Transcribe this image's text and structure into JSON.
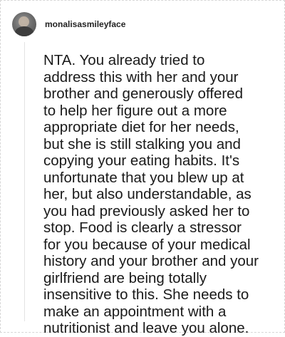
{
  "comment": {
    "username": "monalisasmileyface",
    "avatar_icon": "user-avatar",
    "text": "NTA. You already tried to\naddress this with her and your\nbrother and generously offered\nto help her figure out a more\nappropriate diet for her needs,\nbut she is still stalking you and\ncopying your eating habits. It's\nunfortunate that you blew up at\nher, but also understandable, as\nyou had previously asked her to\nstop. Food is clearly a stressor\nfor you because of your medical\nhistory and your brother and your\ngirlfriend are being totally\ninsensitive to this. She needs to\nmake an appointment with a\nnutritionist and leave you alone."
  }
}
